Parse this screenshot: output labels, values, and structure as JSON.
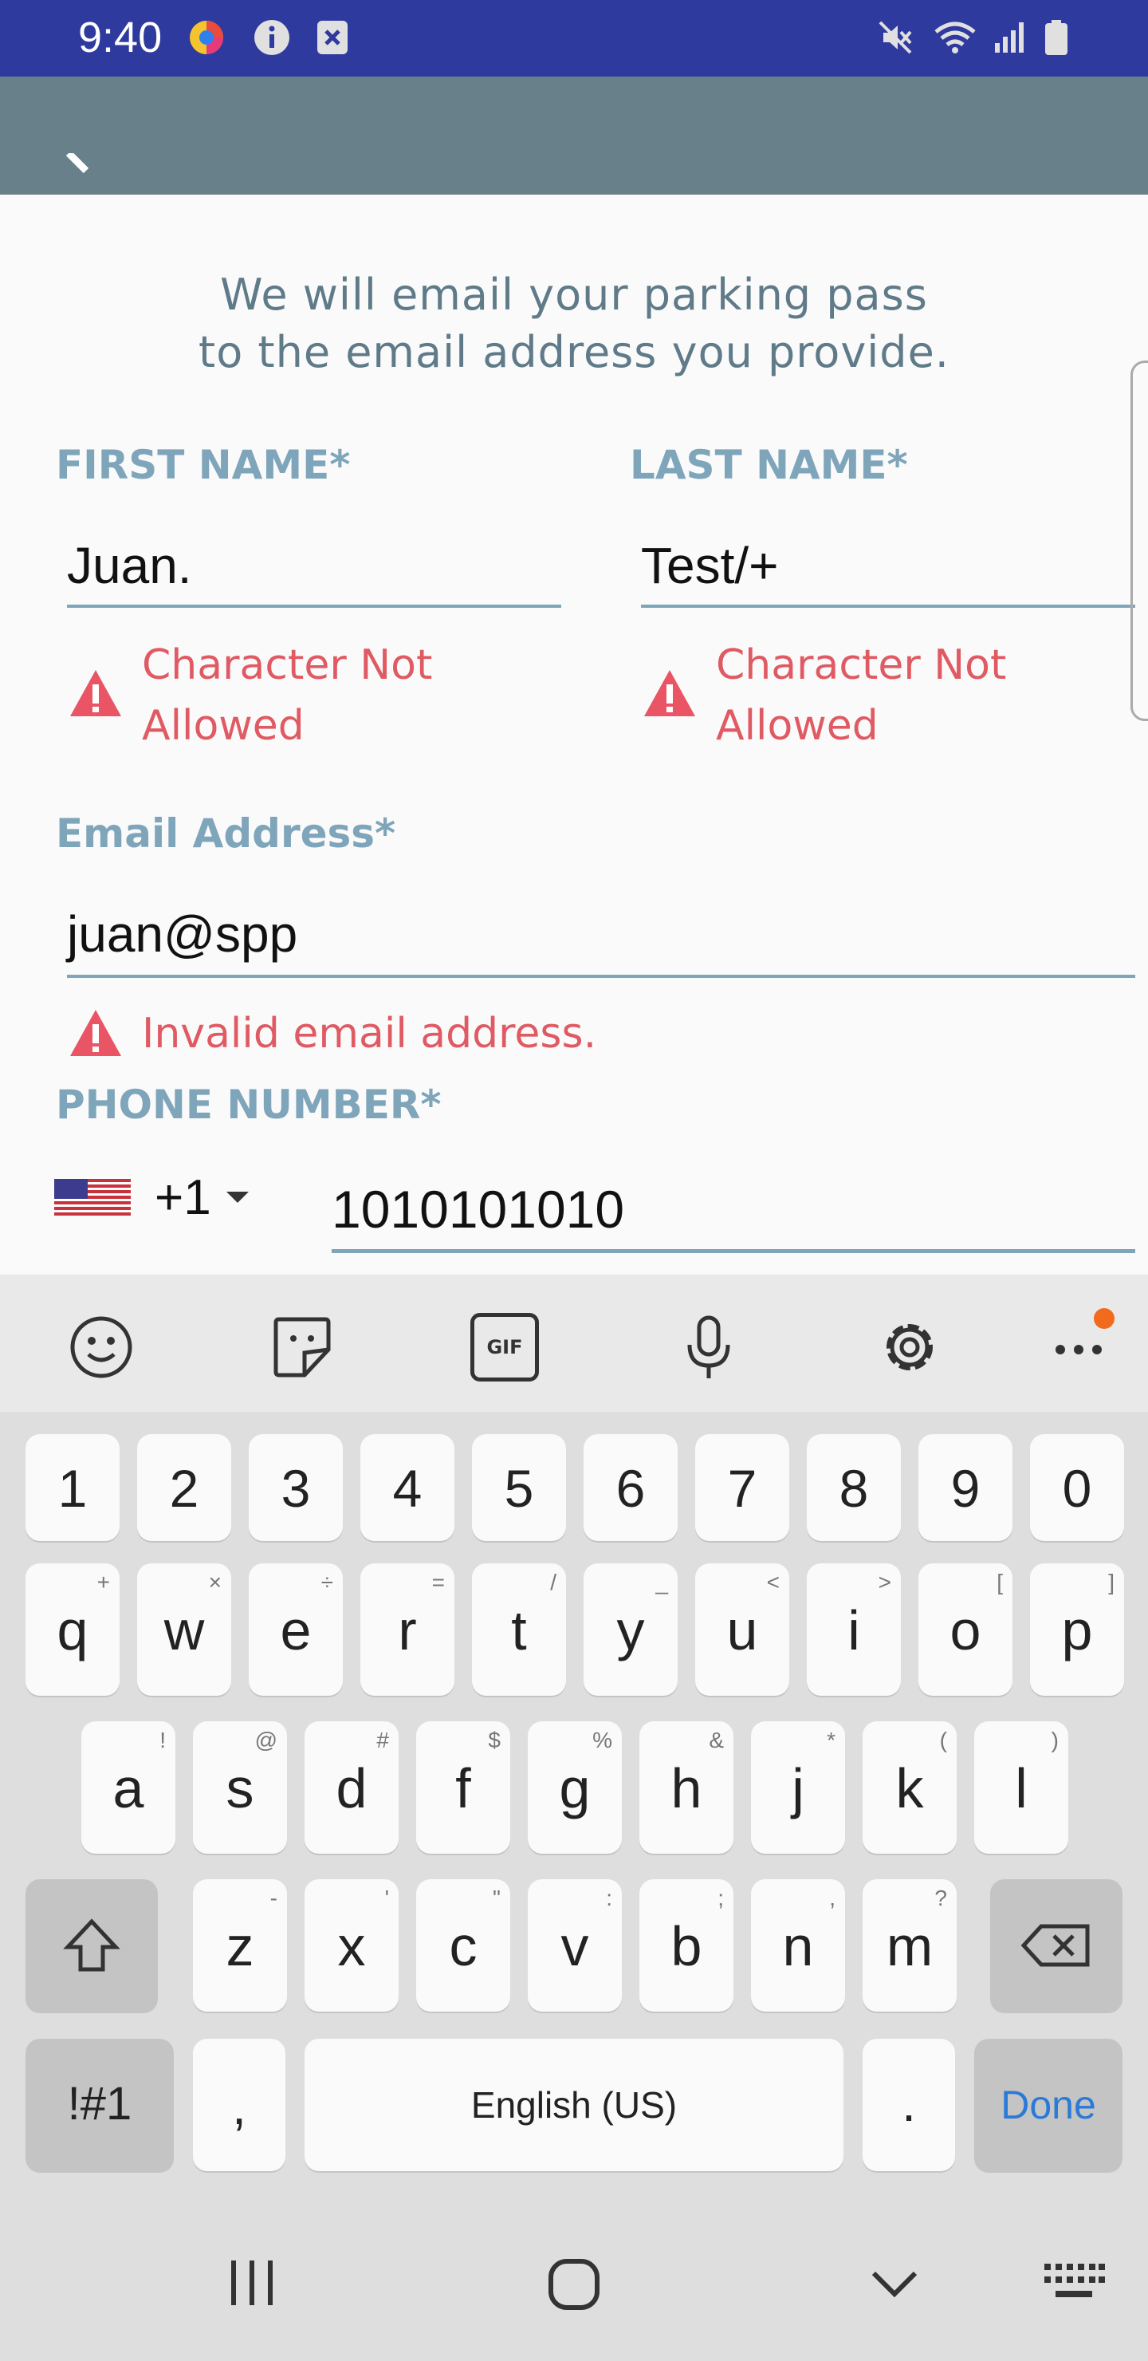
{
  "status_bar": {
    "time": "9:40",
    "icons_left": [
      "browser-app-icon",
      "info-icon",
      "notification-x-icon"
    ],
    "icons_right": [
      "mute-icon",
      "wifi-icon",
      "signal-icon",
      "battery-icon"
    ]
  },
  "header": {
    "background": "#678089"
  },
  "form": {
    "intro_line1": "We will email your parking pass",
    "intro_line2": "to the email address you provide.",
    "first_name": {
      "label": "FIRST NAME*",
      "value": "Juan.",
      "error_line1": "Character Not",
      "error_line2": "Allowed"
    },
    "last_name": {
      "label": "LAST NAME*",
      "value": "Test/+",
      "error_line1": "Character Not",
      "error_line2": "Allowed"
    },
    "email": {
      "label": "Email Address*",
      "value": "juan@spp",
      "error": "Invalid email address."
    },
    "phone": {
      "label": "PHONE NUMBER*",
      "country_code": "+1",
      "value": "1010101010",
      "flag": "us-flag-icon"
    }
  },
  "colors": {
    "label": "#7fa5bb",
    "error": "#e05a63",
    "status_bar": "#2f3a9f",
    "done": "#2a7ad8"
  },
  "keyboard": {
    "toolbar": [
      "emoji-icon",
      "sticker-icon",
      "gif-icon",
      "microphone-icon",
      "settings-icon",
      "more-icon"
    ],
    "gif_label": "GIF",
    "row_numbers": [
      "1",
      "2",
      "3",
      "4",
      "5",
      "6",
      "7",
      "8",
      "9",
      "0"
    ],
    "row_q": [
      {
        "key": "q",
        "hint": "+"
      },
      {
        "key": "w",
        "hint": "×"
      },
      {
        "key": "e",
        "hint": "÷"
      },
      {
        "key": "r",
        "hint": "="
      },
      {
        "key": "t",
        "hint": "/"
      },
      {
        "key": "y",
        "hint": "_"
      },
      {
        "key": "u",
        "hint": "<"
      },
      {
        "key": "i",
        "hint": ">"
      },
      {
        "key": "o",
        "hint": "["
      },
      {
        "key": "p",
        "hint": "]"
      }
    ],
    "row_a": [
      {
        "key": "a",
        "hint": "!"
      },
      {
        "key": "s",
        "hint": "@"
      },
      {
        "key": "d",
        "hint": "#"
      },
      {
        "key": "f",
        "hint": "$"
      },
      {
        "key": "g",
        "hint": "%"
      },
      {
        "key": "h",
        "hint": "&"
      },
      {
        "key": "j",
        "hint": "*"
      },
      {
        "key": "k",
        "hint": "("
      },
      {
        "key": "l",
        "hint": ")"
      }
    ],
    "row_z": [
      {
        "key": "z",
        "hint": "-"
      },
      {
        "key": "x",
        "hint": "'"
      },
      {
        "key": "c",
        "hint": "\""
      },
      {
        "key": "v",
        "hint": ":"
      },
      {
        "key": "b",
        "hint": ";"
      },
      {
        "key": "n",
        "hint": ","
      },
      {
        "key": "m",
        "hint": "?"
      }
    ],
    "symbols_label": "!#1",
    "comma_label": ",",
    "space_label": "English (US)",
    "period_label": ".",
    "done_label": "Done"
  },
  "nav_bar": [
    "recent-apps-icon",
    "home-icon",
    "back-chevron-icon",
    "keyboard-switch-icon"
  ]
}
